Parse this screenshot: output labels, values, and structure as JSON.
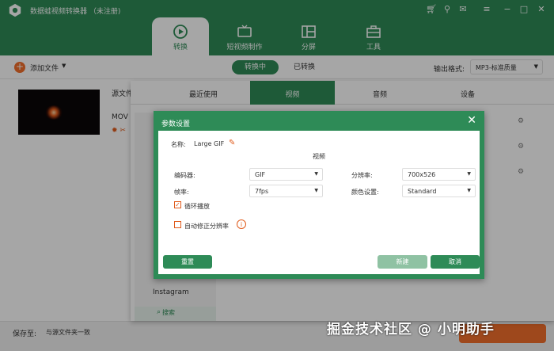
{
  "app": {
    "title": "数据蛙视频转换器 （未注册)"
  },
  "nav": [
    {
      "label": "转换",
      "icon": "convert-icon",
      "active": true
    },
    {
      "label": "短视频制作",
      "icon": "tv-icon",
      "active": false
    },
    {
      "label": "分屏",
      "icon": "split-screen-icon",
      "active": false
    },
    {
      "label": "工具",
      "icon": "toolbox-icon",
      "active": false
    }
  ],
  "toolbar": {
    "add_file": "添加文件",
    "seg_converting": "转换中",
    "seg_converted": "已转换",
    "output_format_label": "输出格式:",
    "output_format_value": "MP3-标准质量"
  },
  "file": {
    "source_label": "源文件",
    "format": "MOV"
  },
  "bottom": {
    "save_to_label": "保存至:",
    "save_path": "与源文件夹一致"
  },
  "format_panel": {
    "tabs": [
      "最近使用",
      "视频",
      "音频",
      "设备"
    ],
    "active_tab": 1,
    "list_item": "Instagram",
    "search_label": "搜索"
  },
  "dialog": {
    "title": "参数设置",
    "name_label": "名称:",
    "name_value": "Large GIF",
    "section": "视频",
    "encoder_label": "编码器:",
    "encoder_value": "GIF",
    "resolution_label": "分辨率:",
    "resolution_value": "700x526",
    "framerate_label": "帧率:",
    "framerate_value": "7fps",
    "color_label": "颜色设置:",
    "color_value": "Standard",
    "loop_label": "循环播放",
    "auto_res_label": "自动修正分辨率",
    "reset_label": "重置",
    "create_label": "新建",
    "cancel_label": "取消"
  },
  "watermark": "掘金技术社区 @ 小明助手",
  "colors": {
    "primary": "#2e8b57",
    "accent": "#f36f2b"
  }
}
